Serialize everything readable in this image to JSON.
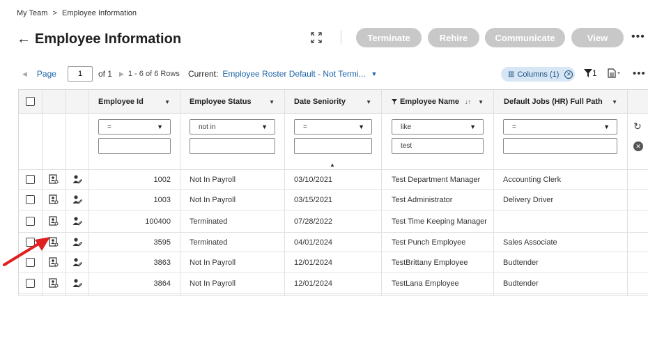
{
  "breadcrumb": {
    "root": "My Team",
    "sep": ">",
    "current": "Employee Information"
  },
  "page": {
    "back_icon": "arrow-left-icon",
    "title": "Employee Information"
  },
  "actions": {
    "terminate": "Terminate",
    "rehire": "Rehire",
    "communicate": "Communicate",
    "view": "View",
    "more": "•••"
  },
  "pager": {
    "page_label": "Page",
    "page_value": "1",
    "of_label": "of 1",
    "rows_label": "1 - 6 of 6 Rows"
  },
  "view_selector": {
    "label": "Current:",
    "value": "Employee Roster Default - Not Termi..."
  },
  "toolbar": {
    "columns_chip": "Columns (1)",
    "filter_count": "1",
    "more": "•••"
  },
  "columns": [
    {
      "label": "Employee Id"
    },
    {
      "label": "Employee Status"
    },
    {
      "label": "Date Seniority"
    },
    {
      "label": "Employee Name"
    },
    {
      "label": "Default Jobs (HR) Full Path"
    }
  ],
  "filters": {
    "employee_id": {
      "operator": "=",
      "value": ""
    },
    "employee_status": {
      "operator": "not in",
      "value": ""
    },
    "date_seniority": {
      "operator": "=",
      "value": ""
    },
    "employee_name": {
      "operator": "like",
      "value": "test"
    },
    "default_jobs": {
      "operator": "=",
      "value": ""
    }
  },
  "rows": [
    {
      "id": "1002",
      "status": "Not In Payroll",
      "date": "03/10/2021",
      "name": "Test Department Manager",
      "job": "Accounting Clerk"
    },
    {
      "id": "1003",
      "status": "Not In Payroll",
      "date": "03/15/2021",
      "name": "Test Administrator",
      "job": "Delivery Driver"
    },
    {
      "id": "100400",
      "status": "Terminated",
      "date": "07/28/2022",
      "name": "Test Time Keeping Manager",
      "job": ""
    },
    {
      "id": "3595",
      "status": "Terminated",
      "date": "04/01/2024",
      "name": "Test Punch Employee",
      "job": "Sales Associate"
    },
    {
      "id": "3863",
      "status": "Not In Payroll",
      "date": "12/01/2024",
      "name": "TestBrittany Employee",
      "job": "Budtender"
    },
    {
      "id": "3864",
      "status": "Not In Payroll",
      "date": "12/01/2024",
      "name": "TestLana Employee",
      "job": "Budtender"
    }
  ],
  "colors": {
    "link_blue": "#1b63a8",
    "disabled_button": "#c8c8c8",
    "chip_bg": "#d6e6f4",
    "annotation_arrow": "#e02020"
  }
}
